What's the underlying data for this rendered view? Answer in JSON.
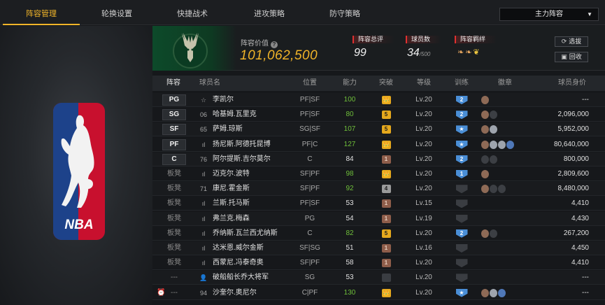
{
  "tabs": [
    "阵容管理",
    "轮换设置",
    "快捷战术",
    "进攻策略",
    "防守策略"
  ],
  "active_tab": 0,
  "lineup_select": {
    "value": "主力阵容"
  },
  "banner": {
    "value_label": "阵容价值",
    "value": "101,062,500",
    "rating_label": "阵容总评",
    "rating": "99",
    "count_label": "球员数",
    "count": "34",
    "count_max": "/500",
    "bond_label": "阵容羁绊",
    "select_btn": "选拔",
    "recycle_btn": "回收"
  },
  "columns": [
    "阵容",
    "球员名",
    "位置",
    "能力",
    "突破",
    "等级",
    "训练",
    "徽章",
    "球员身价"
  ],
  "colors": {
    "accent": "#f0b429",
    "ability_green": "#6fbf3a",
    "training_blue": "#4a8ed6"
  },
  "rows": [
    {
      "slot": "PG",
      "num": "☆",
      "name": "李凯尔",
      "pos": "PF|SF",
      "ability": "100",
      "ag": true,
      "brk": "👑",
      "bk": "gold",
      "lv": "Lv.20",
      "train": "2",
      "tr": "blue",
      "badges": [
        "b"
      ],
      "price": "---"
    },
    {
      "slot": "SG",
      "num": "06",
      "name": "哈基姆.瓦里克",
      "pos": "PF|SF",
      "ability": "80",
      "ag": true,
      "brk": "5",
      "bk": "gold",
      "lv": "Lv.20",
      "train": "2",
      "tr": "blue",
      "badges": [
        "b",
        "d"
      ],
      "price": "2,096,000"
    },
    {
      "slot": "SF",
      "num": "65",
      "name": "萨姆.琼斯",
      "pos": "SG|SF",
      "ability": "107",
      "ag": true,
      "brk": "5",
      "bk": "gold",
      "lv": "Lv.20",
      "train": "★",
      "tr": "blue",
      "badges": [
        "b",
        "s"
      ],
      "price": "5,952,000"
    },
    {
      "slot": "PF",
      "num": "ıl",
      "name": "扬尼斯.阿德托昆博",
      "pos": "PF|C",
      "ability": "127",
      "ag": true,
      "brk": "👑",
      "bk": "gold",
      "lv": "Lv.20",
      "train": "★",
      "tr": "blue",
      "badges": [
        "b",
        "s",
        "s",
        "h"
      ],
      "price": "80,640,000"
    },
    {
      "slot": "C",
      "num": "76",
      "name": "阿尔提斯.吉尔莫尔",
      "pos": "C",
      "ability": "84",
      "ag": false,
      "brk": "1",
      "bk": "bronze",
      "lv": "Lv.20",
      "train": "2",
      "tr": "blue",
      "badges": [
        "d",
        "d"
      ],
      "price": "800,000"
    },
    {
      "slot": "板凳",
      "num": "ıl",
      "name": "迈克尔.波特",
      "pos": "SF|PF",
      "ability": "98",
      "ag": true,
      "brk": "👑",
      "bk": "gold",
      "lv": "Lv.20",
      "train": "1",
      "tr": "blue",
      "badges": [
        "b"
      ],
      "price": "2,809,600"
    },
    {
      "slot": "板凳",
      "num": "71",
      "name": "康尼.霍金斯",
      "pos": "SF|PF",
      "ability": "92",
      "ag": true,
      "brk": "4",
      "bk": "silver",
      "lv": "Lv.20",
      "train": "",
      "tr": "dim",
      "badges": [
        "b",
        "d",
        "d"
      ],
      "price": "8,480,000"
    },
    {
      "slot": "板凳",
      "num": "ıl",
      "name": "兰斯.托马斯",
      "pos": "PF|SF",
      "ability": "53",
      "ag": false,
      "brk": "1",
      "bk": "bronze",
      "lv": "Lv.15",
      "train": "",
      "tr": "dim",
      "badges": [],
      "price": "4,410"
    },
    {
      "slot": "板凳",
      "num": "ıl",
      "name": "弗兰克.梅森",
      "pos": "PG",
      "ability": "54",
      "ag": false,
      "brk": "1",
      "bk": "bronze",
      "lv": "Lv.19",
      "train": "",
      "tr": "dim",
      "badges": [],
      "price": "4,430"
    },
    {
      "slot": "板凳",
      "num": "ıl",
      "name": "乔纳斯.瓦兰西尤纳斯",
      "pos": "C",
      "ability": "82",
      "ag": true,
      "brk": "5",
      "bk": "gold",
      "lv": "Lv.20",
      "train": "2",
      "tr": "blue",
      "badges": [
        "b",
        "d"
      ],
      "price": "267,200"
    },
    {
      "slot": "板凳",
      "num": "ıl",
      "name": "达米恩.威尔金斯",
      "pos": "SF|SG",
      "ability": "51",
      "ag": false,
      "brk": "1",
      "bk": "bronze",
      "lv": "Lv.16",
      "train": "",
      "tr": "dim",
      "badges": [],
      "price": "4,450"
    },
    {
      "slot": "板凳",
      "num": "ıl",
      "name": "西蒙尼.冯泰奇奥",
      "pos": "SF|PF",
      "ability": "58",
      "ag": false,
      "brk": "1",
      "bk": "bronze",
      "lv": "Lv.20",
      "train": "",
      "tr": "dim",
      "badges": [],
      "price": "4,410"
    },
    {
      "slot": "---",
      "num": "👤",
      "name": "破船船长乔大将军",
      "pos": "SG",
      "ability": "53",
      "ag": false,
      "brk": "",
      "bk": "dim",
      "lv": "Lv.20",
      "train": "",
      "tr": "dim",
      "badges": [],
      "price": "---"
    },
    {
      "slot": "---",
      "num": "94",
      "name": "沙奎尔.奥尼尔",
      "pos": "C|PF",
      "ability": "130",
      "ag": true,
      "brk": "👑",
      "bk": "gold",
      "lv": "Lv.20",
      "train": "★",
      "tr": "blue",
      "badges": [
        "b",
        "s",
        "h"
      ],
      "price": "---"
    }
  ]
}
